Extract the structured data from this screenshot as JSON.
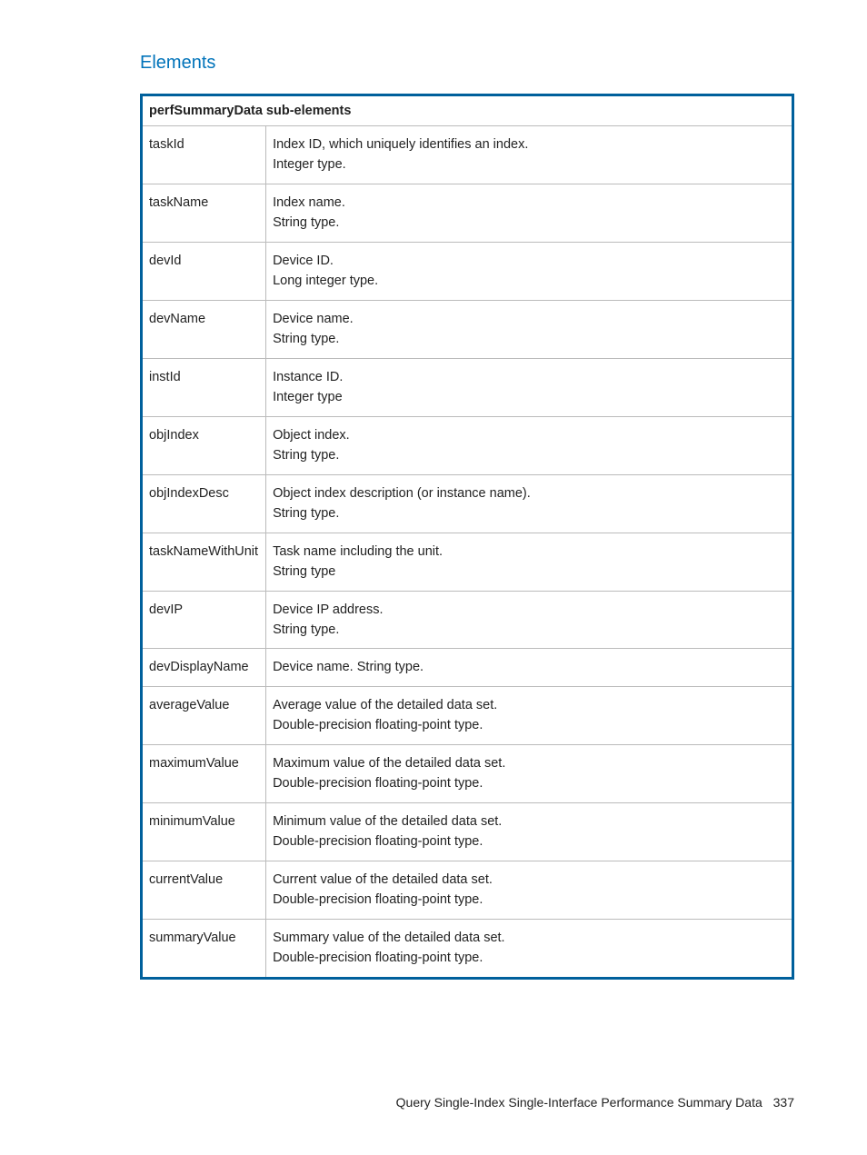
{
  "section": {
    "title": "Elements"
  },
  "table": {
    "header": "perfSummaryData sub-elements",
    "rows": [
      {
        "name": "taskId",
        "desc": "Index ID, which uniquely identifies an index.\nInteger type."
      },
      {
        "name": "taskName",
        "desc": "Index name.\nString type."
      },
      {
        "name": "devId",
        "desc": "Device ID.\nLong integer type."
      },
      {
        "name": "devName",
        "desc": "Device name.\nString type."
      },
      {
        "name": "instId",
        "desc": "Instance ID.\nInteger type"
      },
      {
        "name": "objIndex",
        "desc": "Object index.\nString type."
      },
      {
        "name": "objIndexDesc",
        "desc": "Object index description (or instance name).\nString type."
      },
      {
        "name": "taskNameWithUnit",
        "desc": "Task name including the unit.\nString type"
      },
      {
        "name": "devIP",
        "desc": "Device IP address.\nString type."
      },
      {
        "name": "devDisplayName",
        "desc": "Device name. String type."
      },
      {
        "name": "averageValue",
        "desc": "Average value of the detailed data set.\nDouble-precision floating-point type."
      },
      {
        "name": "maximumValue",
        "desc": "Maximum value of the detailed data set.\nDouble-precision floating-point type."
      },
      {
        "name": "minimumValue",
        "desc": "Minimum value of the detailed data set.\nDouble-precision floating-point type."
      },
      {
        "name": "currentValue",
        "desc": "Current value of the detailed data set.\nDouble-precision floating-point type."
      },
      {
        "name": "summaryValue",
        "desc": "Summary value of the detailed data set.\nDouble-precision floating-point type."
      }
    ]
  },
  "footer": {
    "text": "Query Single-Index Single-Interface Performance Summary Data",
    "page": "337"
  }
}
